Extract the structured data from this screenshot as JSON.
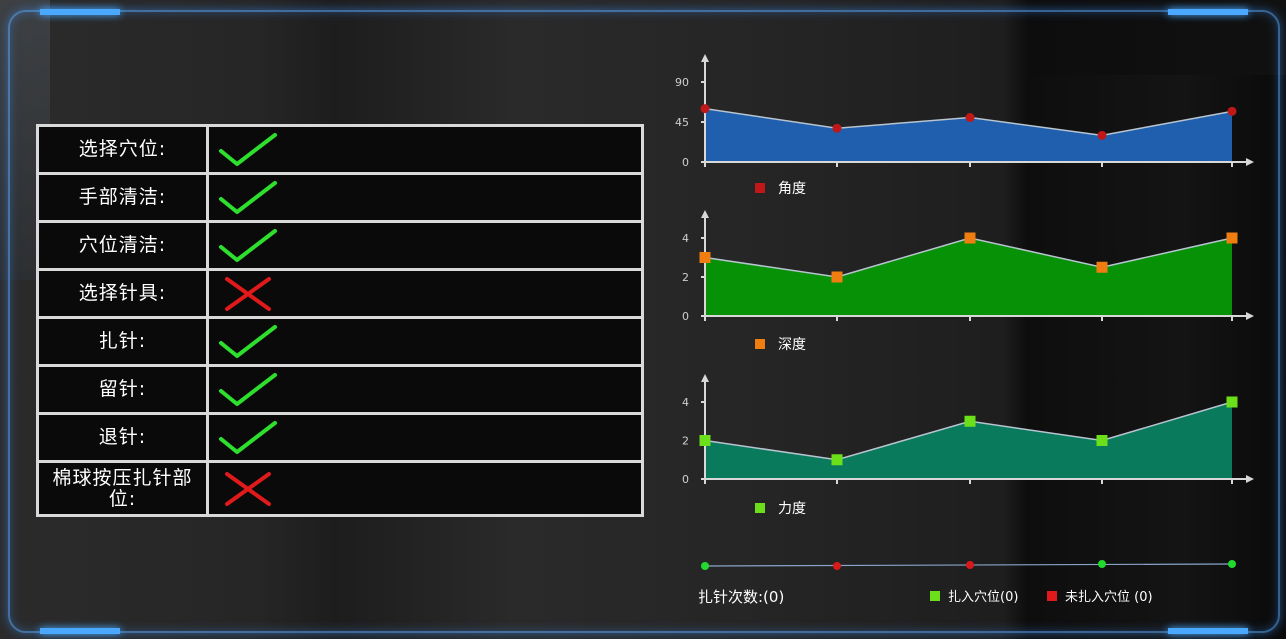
{
  "checklist": [
    {
      "label": "选择穴位:",
      "status": "check"
    },
    {
      "label": "手部清洁:",
      "status": "check"
    },
    {
      "label": "穴位清洁:",
      "status": "check"
    },
    {
      "label": "选择针具:",
      "status": "cross"
    },
    {
      "label": "扎针:",
      "status": "check"
    },
    {
      "label": "留针:",
      "status": "check"
    },
    {
      "label": "退针:",
      "status": "check"
    },
    {
      "label": "棉球按压扎针部位:",
      "status": "cross"
    }
  ],
  "colors": {
    "check": "#2ee02e",
    "cross": "#e01a1a"
  },
  "chart_data": [
    {
      "type": "area",
      "x": [
        1,
        2,
        3,
        4,
        5
      ],
      "values": [
        60,
        38,
        50,
        30,
        57
      ],
      "yticks": [
        "0",
        "45",
        "90"
      ],
      "ylim": [
        0,
        90
      ],
      "legend": "角度",
      "area_color": "#1f5fad",
      "marker_color": "#c01818",
      "marker_shape": "circle"
    },
    {
      "type": "area",
      "x": [
        1,
        2,
        3,
        4,
        5
      ],
      "values": [
        3,
        2,
        4,
        2.5,
        4
      ],
      "yticks": [
        "0",
        "2",
        "4"
      ],
      "ylim": [
        0,
        4
      ],
      "legend": "深度",
      "area_color": "#079107",
      "marker_color": "#f07d10",
      "marker_shape": "square"
    },
    {
      "type": "area",
      "x": [
        1,
        2,
        3,
        4,
        5
      ],
      "values": [
        2,
        1,
        3,
        2,
        4
      ],
      "yticks": [
        "0",
        "2",
        "4"
      ],
      "ylim": [
        0,
        4
      ],
      "legend": "力度",
      "area_color": "#0a7a5c",
      "marker_color": "#6be01a",
      "marker_shape": "square"
    }
  ],
  "needle_track": {
    "points": [
      "green",
      "red",
      "red",
      "green",
      "green"
    ],
    "count_label": "扎针次数:(0)",
    "legend_in": "扎入穴位(0)",
    "legend_out": "未扎入穴位 (0)",
    "color_in": "#6be01a",
    "color_out": "#e01a1a"
  }
}
